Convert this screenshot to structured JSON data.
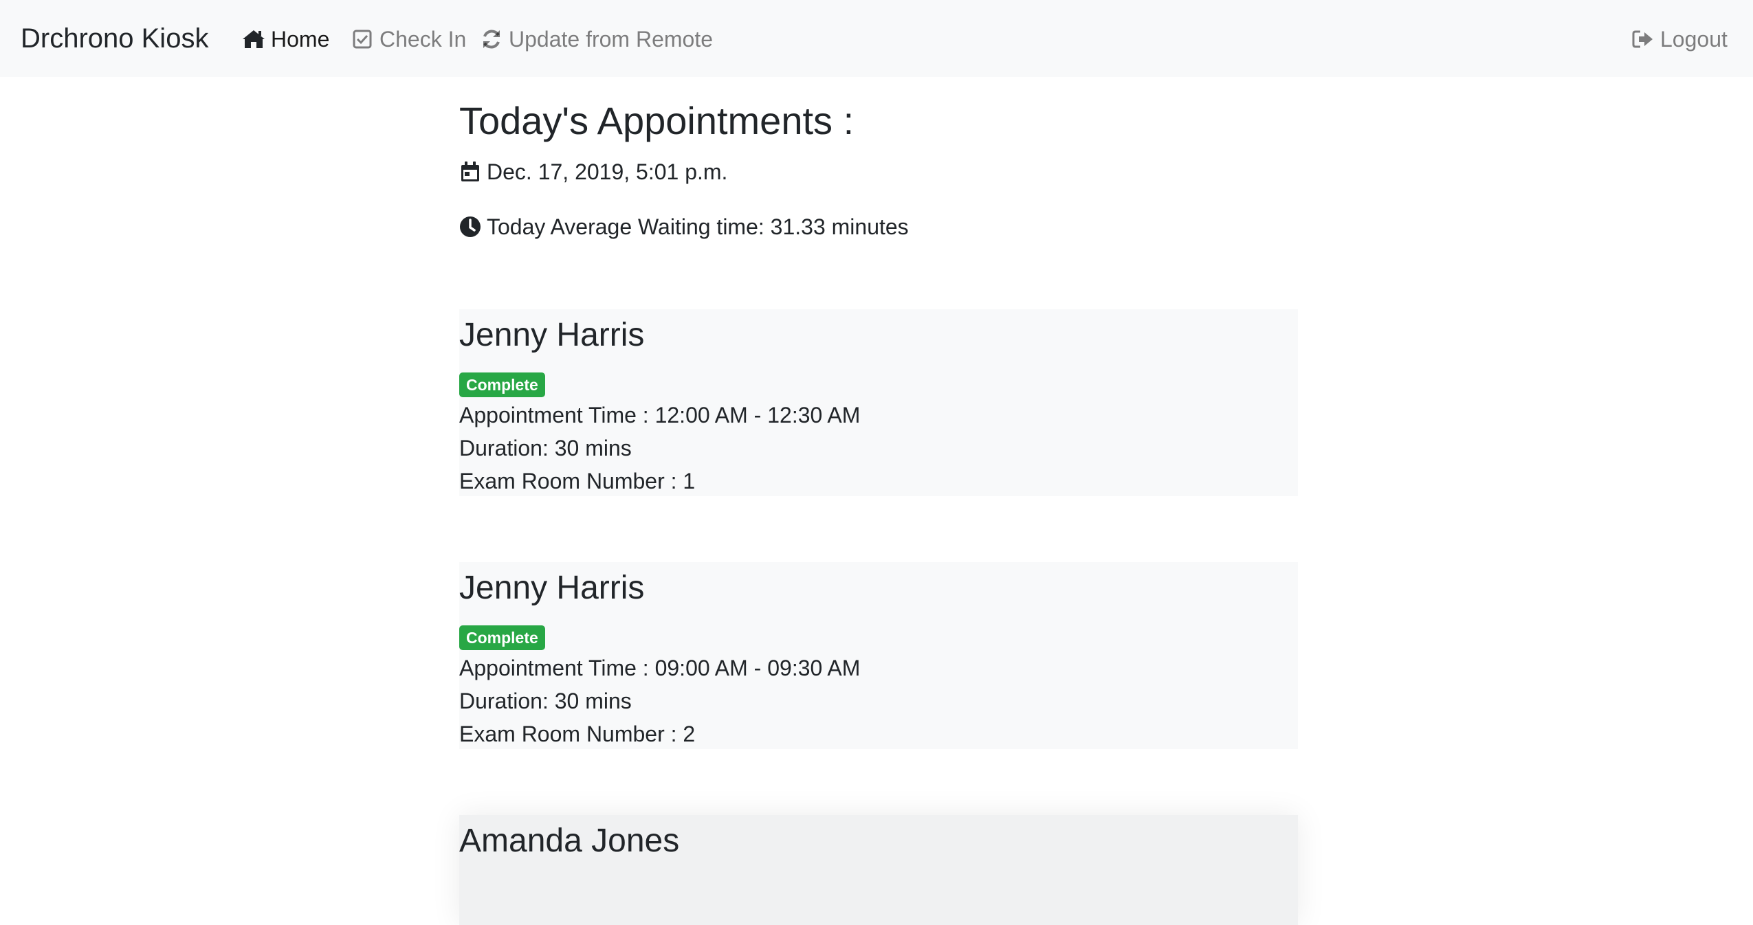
{
  "navbar": {
    "brand": "Drchrono Kiosk",
    "items": [
      {
        "label": "Home",
        "icon": "home-icon",
        "active": true
      },
      {
        "label": "Check In",
        "icon": "check-square-icon",
        "active": false
      },
      {
        "label": "Update from Remote",
        "icon": "refresh-icon",
        "active": false
      }
    ],
    "logout": {
      "label": "Logout",
      "icon": "sign-out-icon"
    }
  },
  "main": {
    "title": "Today's Appointments :",
    "date": "Dec. 17, 2019, 5:01 p.m.",
    "waiting": "Today Average Waiting time: 31.33 minutes"
  },
  "appointments": [
    {
      "patient": "Jenny Harris",
      "status": "Complete",
      "time": "Appointment Time : 12:00 AM - 12:30 AM",
      "duration": "Duration: 30 mins",
      "room": "Exam Room Number : 1"
    },
    {
      "patient": "Jenny Harris",
      "status": "Complete",
      "time": "Appointment Time : 09:00 AM - 09:30 AM",
      "duration": "Duration: 30 mins",
      "room": "Exam Room Number : 2"
    },
    {
      "patient": "Amanda Jones"
    }
  ],
  "colors": {
    "navbar_bg": "#f8f9fa",
    "card_bg": "#f8f9fa",
    "badge_success": "#28a745",
    "text": "#212529",
    "nav_muted": "rgba(0,0,0,0.5)"
  }
}
